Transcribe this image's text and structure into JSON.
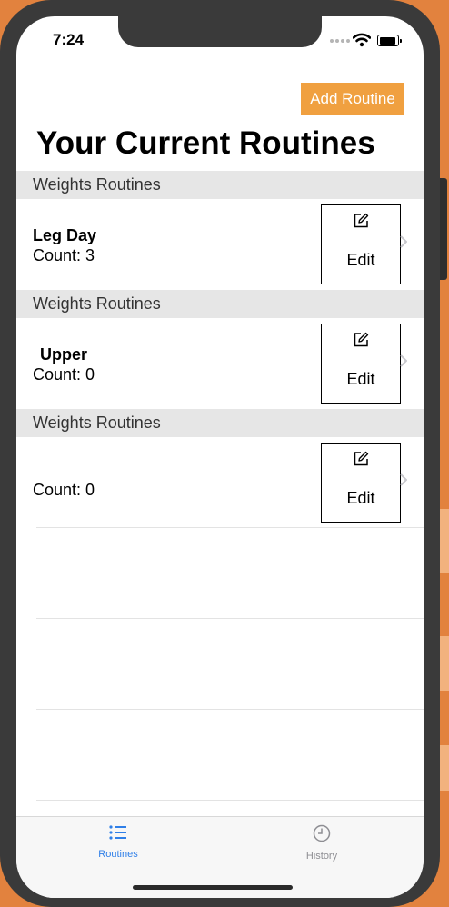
{
  "status_bar": {
    "time": "7:24"
  },
  "header": {
    "add_button": "Add Routine",
    "title": "Your Current Routines"
  },
  "sections": [
    {
      "header": "Weights Routines",
      "name": "Leg Day",
      "count": "Count: 3",
      "edit": "Edit"
    },
    {
      "header": "Weights Routines",
      "name": "Upper",
      "count": "Count: 0",
      "edit": "Edit"
    },
    {
      "header": "Weights Routines",
      "name": "",
      "count": "Count: 0",
      "edit": "Edit"
    }
  ],
  "tabbar": {
    "tabs": [
      {
        "label": "Routines",
        "icon": "list-icon",
        "active": true
      },
      {
        "label": "History",
        "icon": "clock-icon",
        "active": false
      }
    ]
  },
  "colors": {
    "accent": "#f0a040",
    "tab_active": "#2f7fe8",
    "tab_inactive": "#8e8e93",
    "section_bg": "#e6e6e6"
  }
}
